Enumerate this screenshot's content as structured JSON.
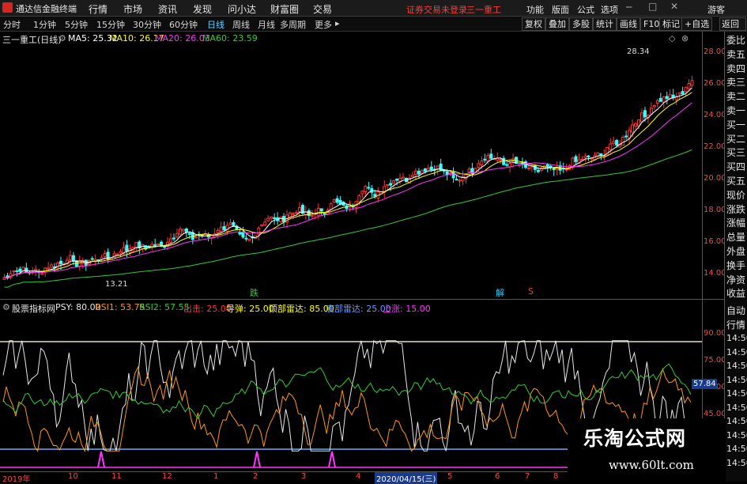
{
  "menubar": {
    "app_title": "通达信金融终端",
    "items": [
      "行情",
      "市场",
      "资讯",
      "发现",
      "问小达",
      "财富圈",
      "交易"
    ],
    "login_status": "证券交易未登录",
    "stock": "三一重工",
    "right_items": [
      "功能",
      "版面",
      "公式",
      "选项"
    ],
    "guest": "游客"
  },
  "periodbar": {
    "periods": [
      "分时",
      "1分钟",
      "5分钟",
      "15分钟",
      "30分钟",
      "60分钟",
      "日线",
      "周线",
      "月线",
      "多周期",
      "更多"
    ],
    "active": "日线",
    "tools": [
      "复权",
      "叠加",
      "多股",
      "统计",
      "画线",
      "F10",
      "标记",
      "+自选",
      "返回"
    ]
  },
  "price_panel": {
    "title": "三一重工(日线)",
    "ma5": "MA5: 25.32",
    "ma10": "MA10: 26.17",
    "ma20": "MA20: 26.03",
    "ma60": "MA60: 23.59",
    "y_ticks": [
      "28.00",
      "26.00",
      "24.00",
      "22.00",
      "20.00",
      "18.00",
      "16.00",
      "14.00"
    ],
    "high_label": "28.34",
    "low_label": "13.21",
    "signal_labels": [
      "跌",
      "解",
      "S"
    ]
  },
  "indicator_panel": {
    "name": "股票指标网",
    "psy": "PSY: 80.00",
    "rsi1": "RSI1: 53.75",
    "rsi2": "RSI2: 57.55",
    "chu": "出击: 25.00",
    "dao": "导弹: 25.00",
    "top": "顶部雷达: 85.00",
    "bottom": "底部雷达: 25.00",
    "up": "上涨: 15.00",
    "y_ticks": [
      "90.00",
      "75.00",
      "60.00",
      "45.00"
    ],
    "current_value": "57.84"
  },
  "x_axis": {
    "labels": [
      "2019年",
      "10",
      "11",
      "12",
      "1",
      "2",
      "3",
      "4",
      "2020/04/15(三)",
      "5",
      "6",
      "7",
      "8"
    ]
  },
  "right_panel": {
    "top_items": [
      "委比",
      "卖五",
      "卖四",
      "卖三",
      "卖二",
      "卖一",
      "买一",
      "买二",
      "买三",
      "买四",
      "买五",
      "现价",
      "涨跌",
      "涨幅",
      "总量",
      "外盘",
      "换手",
      "净资",
      "收益"
    ],
    "bottom_items": [
      "自动",
      "行情",
      "14:50",
      "14:50",
      "14:50",
      "14:50",
      "14:50",
      "14:50",
      "14:50",
      "14:50",
      "14:50",
      "14:50"
    ]
  },
  "watermark": {
    "title": "乐淘公式网",
    "url": "www.60lt.com"
  },
  "colors": {
    "up": "#ff3333",
    "down": "#33ffff",
    "ma5": "#ffffff",
    "ma10": "#ffff00",
    "ma20": "#ff33ff",
    "ma60": "#33cc33",
    "psy": "#e6e6e6",
    "rsi1": "#ff9900",
    "rsi2": "#33cc33"
  }
}
